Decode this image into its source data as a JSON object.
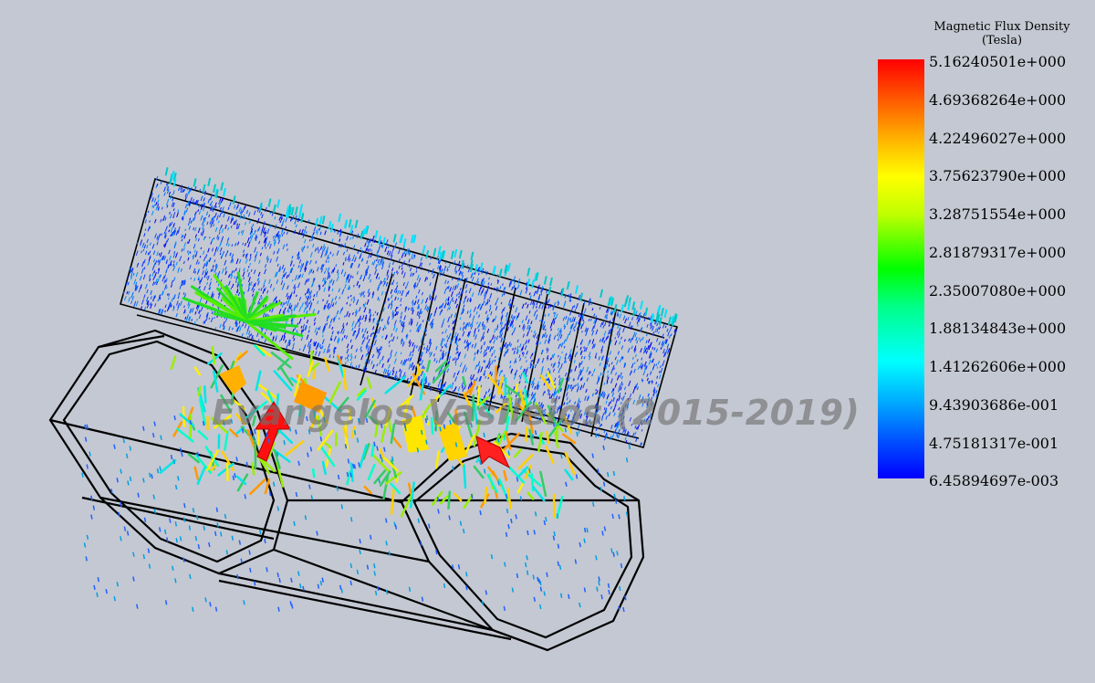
{
  "legend": {
    "title_line1": "Magnetic Flux Density",
    "title_line2": "(Tesla)",
    "ticks": [
      "5.16240501e+000",
      "4.69368264e+000",
      "4.22496027e+000",
      "3.75623790e+000",
      "3.28751554e+000",
      "2.81879317e+000",
      "2.35007080e+000",
      "1.88134843e+000",
      "1.41262606e+000",
      "9.43903686e-001",
      "4.75181317e-001",
      "6.45894697e-003"
    ],
    "colors": [
      "#ff0000",
      "#ff6600",
      "#ffbb00",
      "#ffff00",
      "#bfff00",
      "#00ff00",
      "#00ff88",
      "#00ffff",
      "#00a8ff",
      "#0050ff",
      "#0000ff"
    ]
  },
  "watermark": "Evangelos Vasileios (2015-2019)",
  "background_color": "#c4c8d2"
}
